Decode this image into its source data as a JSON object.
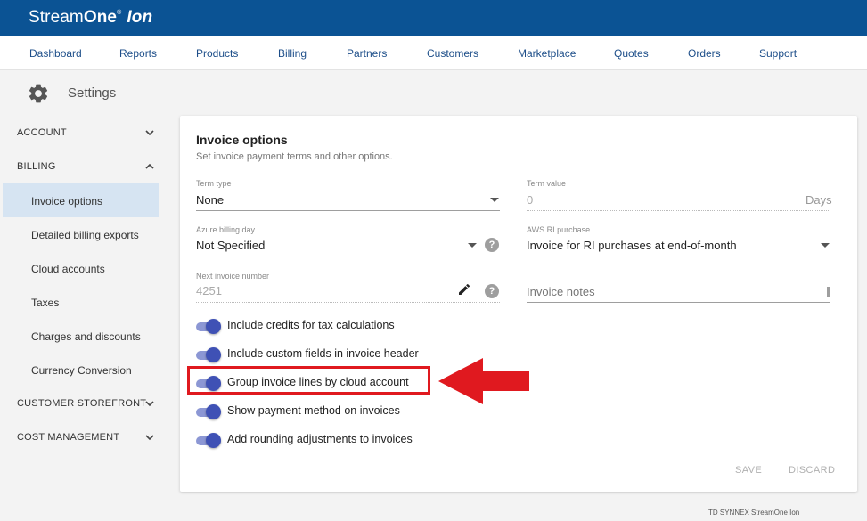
{
  "brand": {
    "part1": "Stream",
    "part2": "One",
    "reg": "®",
    "part3": "Ion"
  },
  "nav": [
    "Dashboard",
    "Reports",
    "Products",
    "Billing",
    "Partners",
    "Customers",
    "Marketplace",
    "Quotes",
    "Orders",
    "Support"
  ],
  "settings": {
    "title": "Settings",
    "icon": "gear-icon"
  },
  "sidebar": {
    "account": "ACCOUNT",
    "billing": "BILLING",
    "billing_items": [
      "Invoice options",
      "Detailed billing exports",
      "Cloud accounts",
      "Taxes",
      "Charges and discounts",
      "Currency Conversion"
    ],
    "active_item": "Invoice options",
    "customer_storefront": "CUSTOMER STOREFRONT",
    "cost_management": "COST MANAGEMENT"
  },
  "card": {
    "title": "Invoice options",
    "subtitle": "Set invoice payment terms and other options.",
    "term_type": {
      "label": "Term type",
      "value": "None"
    },
    "term_value": {
      "label": "Term value",
      "value": "0",
      "suffix": "Days"
    },
    "azure_billing_day": {
      "label": "Azure billing day",
      "value": "Not Specified"
    },
    "aws_ri": {
      "label": "AWS RI purchase",
      "value": "Invoice for RI purchases at end-of-month"
    },
    "next_invoice": {
      "label": "Next invoice number",
      "value": "4251"
    },
    "invoice_notes": {
      "placeholder": "Invoice notes"
    },
    "toggles": [
      {
        "label": "Include credits for tax calculations",
        "on": true
      },
      {
        "label": "Include custom fields in invoice header",
        "on": true
      },
      {
        "label": "Group invoice lines by cloud account",
        "on": true
      },
      {
        "label": "Show payment method on invoices",
        "on": true
      },
      {
        "label": "Add rounding adjustments to invoices",
        "on": true
      }
    ],
    "save": "SAVE",
    "discard": "DISCARD"
  },
  "footer": "TD SYNNEX StreamOne Ion",
  "colors": {
    "header": "#0b5394",
    "toggle": "#3f51b5",
    "highlight": "#e0191f"
  }
}
